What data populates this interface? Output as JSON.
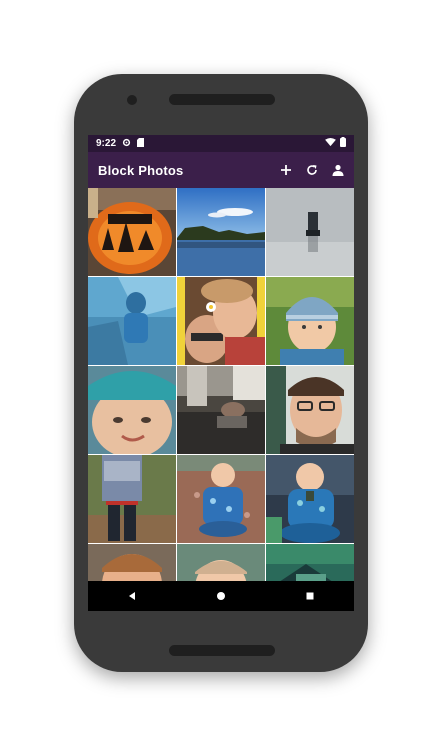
{
  "status_bar": {
    "time": "9:22",
    "icons": [
      "gear-icon",
      "sd-card-icon",
      "wifi-icon",
      "battery-icon"
    ]
  },
  "app_bar": {
    "title": "Block Photos",
    "actions": [
      "add-icon",
      "refresh-icon",
      "account-icon"
    ]
  },
  "photos": [
    {
      "subject": "halloween-plate"
    },
    {
      "subject": "lake-landscape"
    },
    {
      "subject": "foggy-figure"
    },
    {
      "subject": "child-in-car-seat"
    },
    {
      "subject": "adult-and-child-selfie"
    },
    {
      "subject": "child-in-knit-hat"
    },
    {
      "subject": "smiling-child-closeup"
    },
    {
      "subject": "living-room-scene"
    },
    {
      "subject": "man-with-glasses"
    },
    {
      "subject": "child-standing-outdoors"
    },
    {
      "subject": "baby-on-gravel"
    },
    {
      "subject": "baby-sitting"
    },
    {
      "subject": "child-partial"
    },
    {
      "subject": "baby-partial"
    },
    {
      "subject": "outdoor-partial"
    }
  ],
  "nav_bar": {
    "buttons": [
      "back-icon",
      "home-icon",
      "recents-icon"
    ]
  },
  "colors": {
    "status_bar": "#2a1736",
    "app_bar": "#3b1f4a",
    "phone_body": "#3a3a3a"
  }
}
